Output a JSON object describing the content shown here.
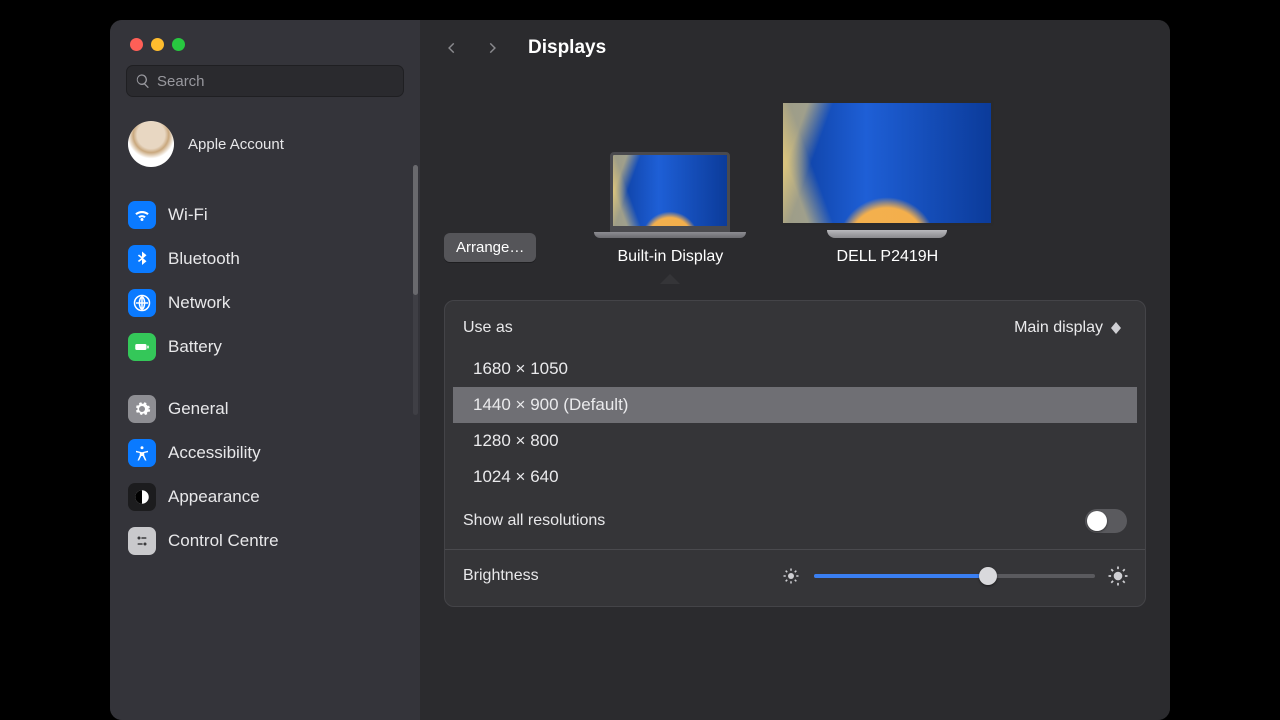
{
  "window": {
    "title": "Displays"
  },
  "search": {
    "placeholder": "Search"
  },
  "account": {
    "label": "Apple Account"
  },
  "sidebar": {
    "items": [
      {
        "label": "Wi-Fi",
        "icon": "wifi",
        "color": "blue"
      },
      {
        "label": "Bluetooth",
        "icon": "bluetooth",
        "color": "blue"
      },
      {
        "label": "Network",
        "icon": "globe",
        "color": "blue"
      },
      {
        "label": "Battery",
        "icon": "battery",
        "color": "green2"
      },
      {
        "label": "General",
        "icon": "gear",
        "color": "gray"
      },
      {
        "label": "Accessibility",
        "icon": "accessibility",
        "color": "blue"
      },
      {
        "label": "Appearance",
        "icon": "appearance",
        "color": "dark"
      },
      {
        "label": "Control Centre",
        "icon": "controls",
        "color": "lgray"
      }
    ]
  },
  "displays": {
    "arrange_label": "Arrange…",
    "list": [
      {
        "label": "Built-in Display",
        "kind": "laptop",
        "selected": true
      },
      {
        "label": "DELL P2419H",
        "kind": "monitor",
        "selected": false
      }
    ]
  },
  "use_as": {
    "label": "Use as",
    "value": "Main display"
  },
  "resolutions": {
    "options": [
      {
        "label": "1680 × 1050"
      },
      {
        "label": "1440 × 900 (Default)",
        "selected": true
      },
      {
        "label": "1280 × 800"
      },
      {
        "label": "1024 × 640"
      }
    ],
    "show_all_label": "Show all resolutions",
    "show_all_value": false
  },
  "brightness": {
    "label": "Brightness",
    "value_pct": 62
  }
}
